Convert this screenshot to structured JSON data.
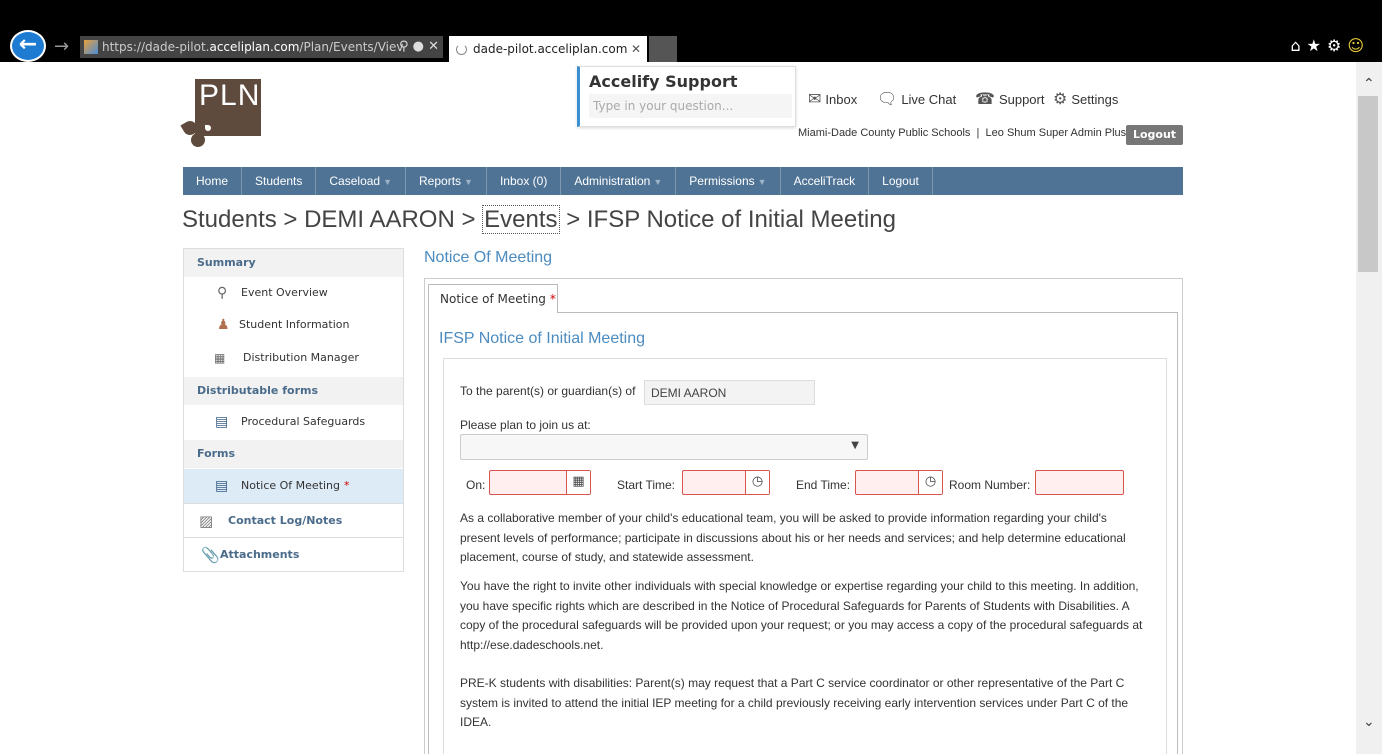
{
  "browser": {
    "url_prefix": "https://dade-pilot.",
    "url_host": "acceliplan.com",
    "url_path": "/Plan/Events/Viev",
    "tab_title": "dade-pilot.acceliplan.com"
  },
  "header": {
    "logo_text": "PLN",
    "support_title": "Accelify Support",
    "support_placeholder": "Type in your question...",
    "links": {
      "inbox": "Inbox",
      "live_chat": "Live Chat",
      "support": "Support",
      "settings": "Settings"
    },
    "org": "Miami-Dade County Public Schools",
    "separator": "|",
    "user": "Leo Shum Super Admin Plus",
    "logout": "Logout"
  },
  "nav": {
    "home": "Home",
    "students": "Students",
    "caseload": "Caseload",
    "reports": "Reports",
    "inbox": "Inbox (0)",
    "administration": "Administration",
    "permissions": "Permissions",
    "accelitrack": "AcceliTrack",
    "logout": "Logout"
  },
  "breadcrumb": {
    "students": "Students",
    "student": "DEMI AARON",
    "events": "Events",
    "current": "IFSP Notice of Initial Meeting",
    "sep": ">"
  },
  "sidebar": {
    "summary": "Summary",
    "event_overview": "Event Overview",
    "student_information": "Student Information",
    "distribution_manager": "Distribution Manager",
    "distributable_forms": "Distributable forms",
    "procedural_safeguards": "Procedural Safeguards",
    "forms": "Forms",
    "notice_of_meeting": "Notice Of Meeting",
    "required_mark": "*",
    "contact_log": "Contact Log/Notes",
    "attachments": "Attachments"
  },
  "main": {
    "title": "Notice Of Meeting",
    "tab_label": "Notice of Meeting",
    "required_mark": "*",
    "form_title": "IFSP Notice of Initial Meeting",
    "parent_label": "To the parent(s) or guardian(s) of",
    "parent_value": "DEMI AARON",
    "location_label": "Please plan to join us at:",
    "on_label": "On:",
    "start_label": "Start Time:",
    "end_label": "End Time:",
    "room_label": "Room Number:",
    "para1": "As a collaborative member of your child's educational team, you will be asked to provide information regarding your child's present levels of performance; participate in discussions about his or her needs and services; and help determine educational placement, course of study, and statewide assessment.",
    "para2": "You have the right to invite other individuals with special knowledge or expertise regarding your child to this meeting. In addition, you have specific rights which are described in the Notice of Procedural Safeguards for Parents of Students with Disabilities. A copy of the procedural safeguards will be provided upon your request; or you may access a copy of the procedural safeguards at http://ese.dadeschools.net.",
    "para3": "PRE-K students with disabilities: Parent(s) may request that a Part C service coordinator or other representative of the Part C system is invited to attend the initial IEP meeting for a child previously receiving early intervention services under Part C of the IDEA."
  }
}
